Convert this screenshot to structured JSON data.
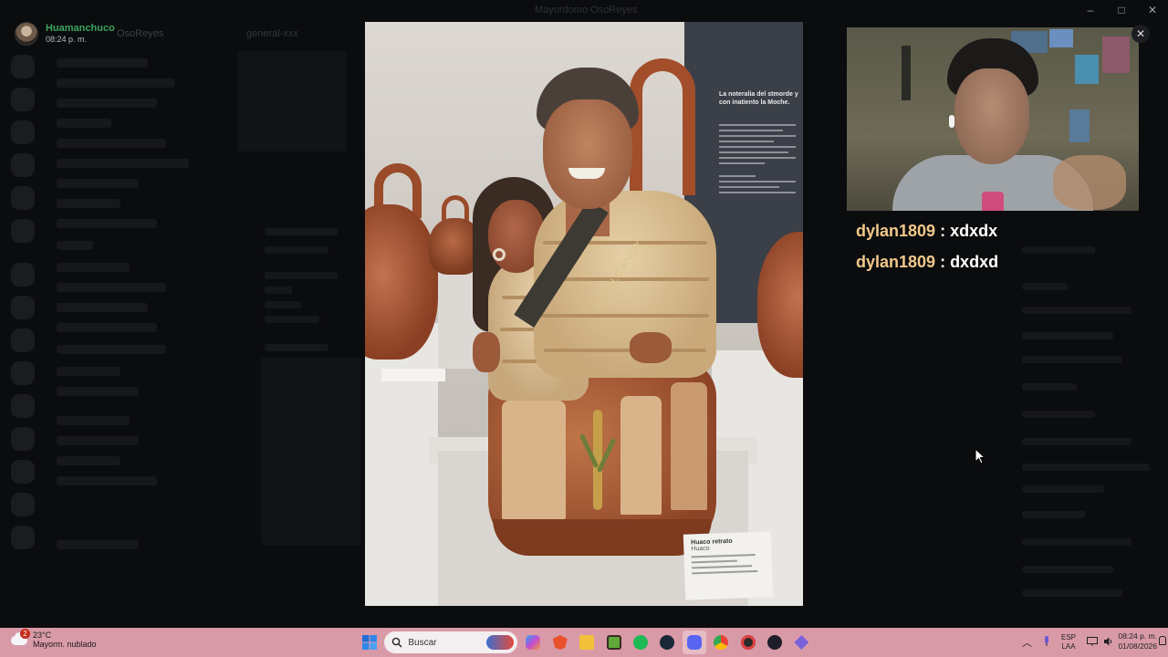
{
  "window": {
    "title": "Mayordomo OsoReyes",
    "controls": [
      "–",
      "□",
      "✕"
    ]
  },
  "background": {
    "server_name": "OsoReyes",
    "channel_name": "general-xxx"
  },
  "viewer": {
    "user_name": "Huamanchuco",
    "timestamp": "08:24 p. m.",
    "close_label": "✕"
  },
  "photo": {
    "wall_heading": "La noteralia del stmorde y con inatiento la Moche.",
    "strap_text": "SKULLCANDY",
    "label_title": "Huaco retrato",
    "label_sub": "Huaco"
  },
  "chat": {
    "messages": [
      {
        "user": "dylan1809",
        "separator": " : ",
        "text": "xdxdx"
      },
      {
        "user": "dylan1809",
        "separator": " : ",
        "text": "dxdxd"
      }
    ]
  },
  "taskbar": {
    "weather_badge": "2",
    "temperature": "23°C",
    "weather_desc": "Mayorm. nublado",
    "search_placeholder": "Buscar",
    "language_top": "ESP",
    "language_bottom": "LAA",
    "time": "08:24 p. m.",
    "date": "01/08/2026",
    "icons": [
      "windows-start-icon",
      "copilot-icon",
      "brave-icon",
      "file-explorer-icon",
      "minecraft-icon",
      "spotify-icon",
      "steam-icon",
      "discord-icon",
      "chrome-icon",
      "obs-icon",
      "app-icon",
      "vpn-icon"
    ]
  },
  "colors": {
    "accent_username": "#3ba55d",
    "chat_user": "#f3c98b",
    "taskbar_bg": "#d99aa8"
  }
}
